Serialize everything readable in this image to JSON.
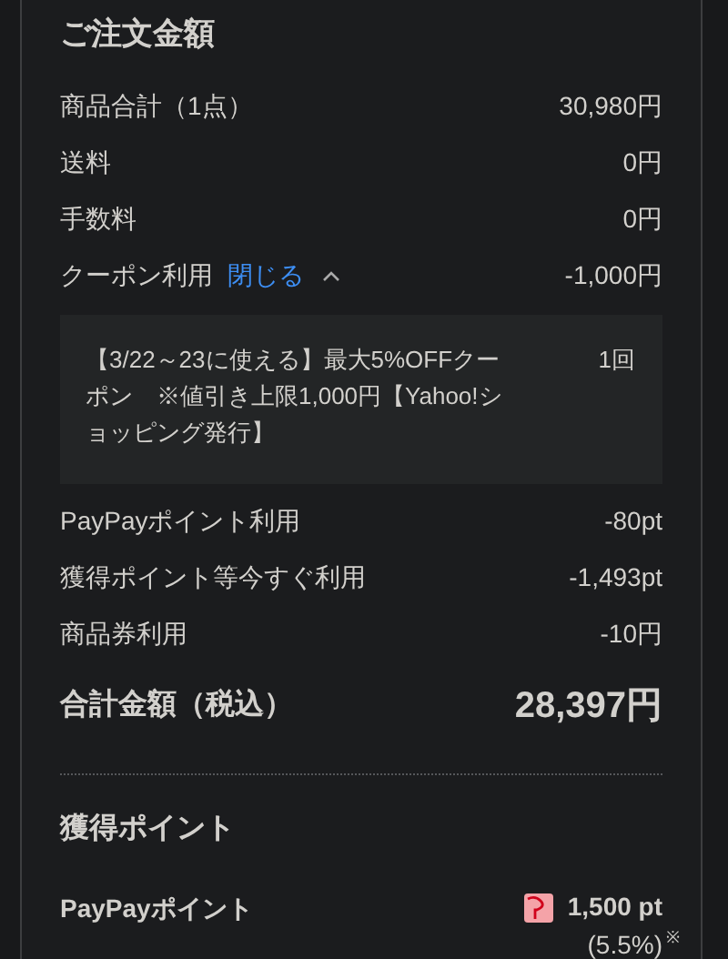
{
  "title": "ご注文金額",
  "rows": [
    {
      "label": "商品合計（1点）",
      "value": "30,980円"
    },
    {
      "label": "送料",
      "value": "0円"
    },
    {
      "label": "手数料",
      "value": "0円"
    }
  ],
  "coupon": {
    "label": "クーポン利用",
    "toggle": "閉じる",
    "expanded": true,
    "value": "-1,000円",
    "description": "【3/22～23に使える】最大5%OFFクーポン　※値引き上限1,000円【Yahoo!ショッピング発行】",
    "count": "1回"
  },
  "rows_after": [
    {
      "label": "PayPayポイント利用",
      "value": "-80pt"
    },
    {
      "label": "獲得ポイント等今すぐ利用",
      "value": "-1,493pt"
    },
    {
      "label": "商品券利用",
      "value": "-10円"
    }
  ],
  "total": {
    "label": "合計金額（税込）",
    "value": "28,397円"
  },
  "points": {
    "title": "獲得ポイント",
    "label": "PayPayポイント",
    "value": "1,500 pt",
    "rate": "(5.5%)",
    "note": "※"
  }
}
